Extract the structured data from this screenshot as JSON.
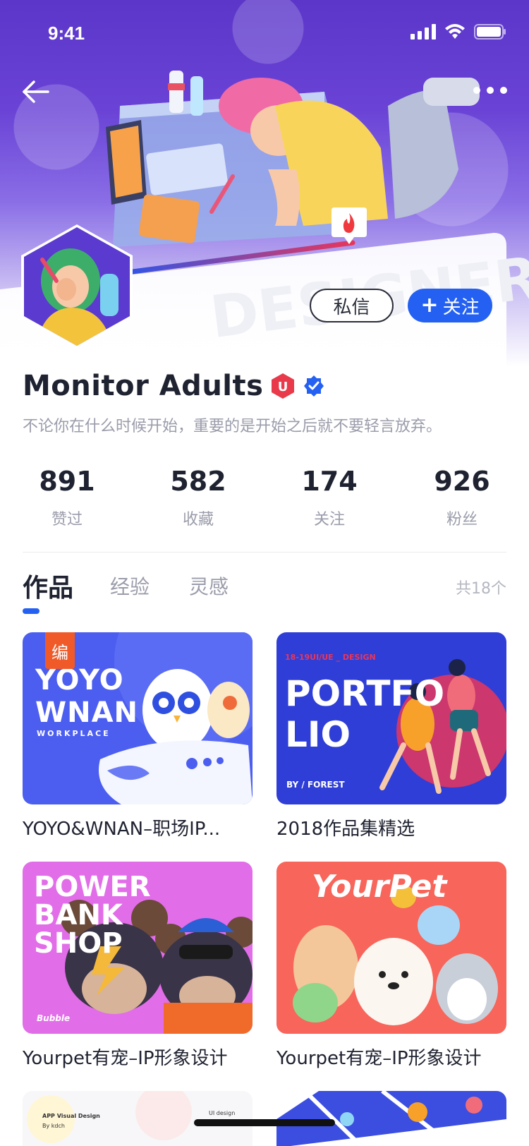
{
  "status": {
    "time": "9:41"
  },
  "profile": {
    "name": "Monitor Adults",
    "bio": "不论你在什么时候开始，重要的是开始之后就不要轻言放弃。",
    "badge_letter": "U"
  },
  "actions": {
    "message_label": "私信",
    "follow_label": "关注"
  },
  "banner": {
    "watermark": "DESIGNER"
  },
  "stats": [
    {
      "value": "891",
      "label": "赞过"
    },
    {
      "value": "582",
      "label": "收藏"
    },
    {
      "value": "174",
      "label": "关注"
    },
    {
      "value": "926",
      "label": "粉丝"
    }
  ],
  "tabs": [
    {
      "label": "作品",
      "active": true
    },
    {
      "label": "经验",
      "active": false
    },
    {
      "label": "灵感",
      "active": false
    }
  ],
  "tab_count": "共18个",
  "works": [
    {
      "title": "YOYO&WNAN–职场IP...",
      "badge": "编",
      "thumb_lines": [
        "YOYO",
        "WNAN"
      ],
      "thumb_sub": "WORKPLACE",
      "color": "#4c5ef0"
    },
    {
      "title": "2018作品集精选",
      "thumb_lines": [
        "PORTFO",
        "LIO"
      ],
      "thumb_sub": "BY / FOREST",
      "thumb_top": "18-19UI/UE _ DESIGN",
      "color": "#2f3ed6"
    },
    {
      "title": "Yourpet有宠–IP形象设计",
      "thumb_lines": [
        "POWER",
        "BANK",
        "SHOP"
      ],
      "thumb_sub": "Bubble",
      "color": "#e26de8"
    },
    {
      "title": "Yourpet有宠–IP形象设计",
      "thumb_lines": [
        "YourPet"
      ],
      "color": "#f7655b"
    }
  ],
  "partial_cards": [
    {
      "line1": "APP Visual Design",
      "line2": "By kdch",
      "line3": "UI design"
    }
  ],
  "colors": {
    "accent": "#2461f2",
    "hero": "#6a43d6",
    "badge_red": "#e83a4a"
  }
}
